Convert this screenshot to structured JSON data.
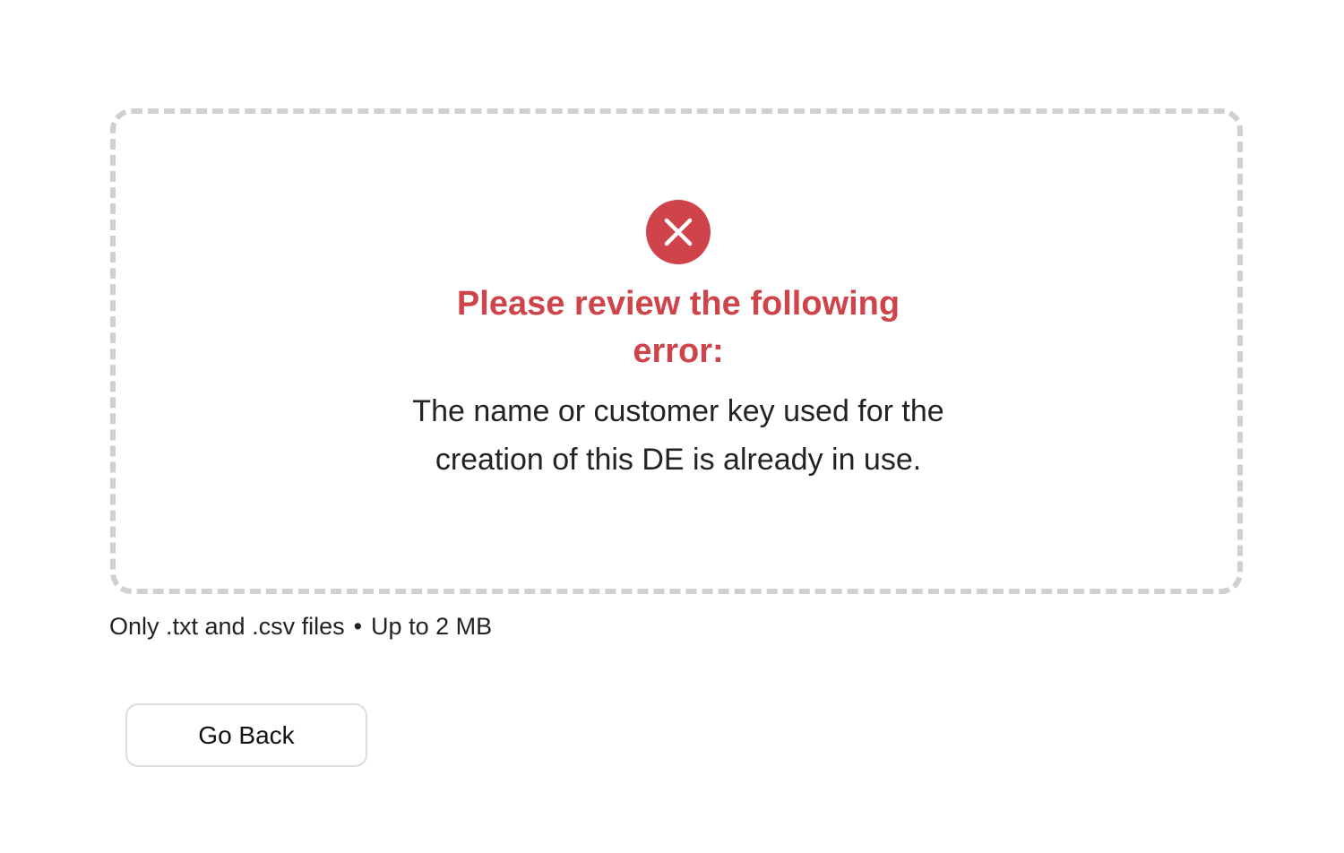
{
  "error": {
    "icon": "error-x-circle-icon",
    "title": "Please review the following error:",
    "message": "The name or customer key used for the creation of this DE is already in use."
  },
  "file_hint": {
    "types": "Only .txt and .csv files",
    "separator": "•",
    "size_limit": "Up to 2 MB"
  },
  "actions": {
    "go_back_label": "Go Back"
  },
  "colors": {
    "error_red": "#cf434b",
    "dropzone_border": "#d0d0d0",
    "text": "#222326",
    "button_border": "#dcdde0"
  }
}
